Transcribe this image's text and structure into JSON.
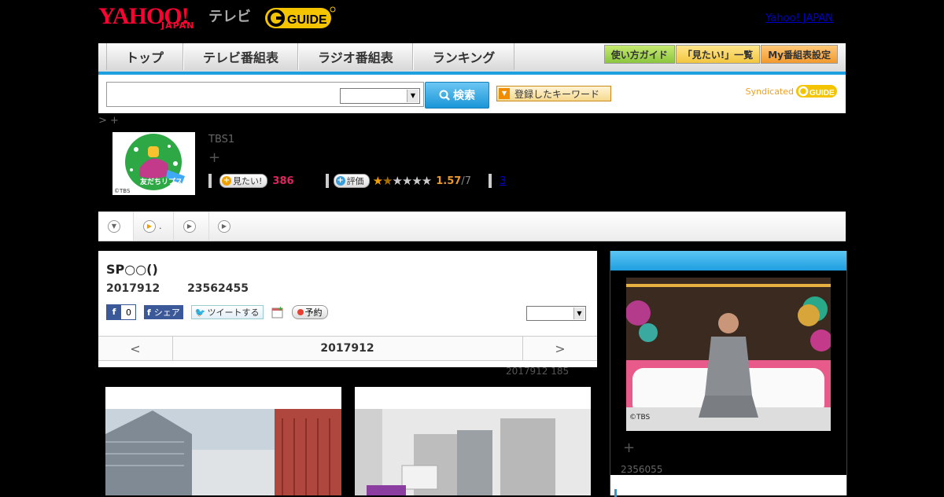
{
  "header": {
    "logo_yahoo": "YAHOO!",
    "logo_japan": "JAPAN",
    "logo_tv": "テレビ",
    "logo_gguide": "G GUIDE",
    "yahoo_japan_link": "Yahoo! JAPAN"
  },
  "nav": {
    "tabs": [
      "トップ",
      "テレビ番組表",
      "ラジオ番組表",
      "ランキング"
    ],
    "buttons": [
      {
        "label": "使い方ガイド",
        "color": "#9bd13b"
      },
      {
        "label": "「見たい!」一覧",
        "color": "#f2c640"
      },
      {
        "label": "My番組表設定",
        "color": "#f29a2e"
      }
    ]
  },
  "search": {
    "button_label": "検索",
    "keyword_button": "登録したキーワード",
    "syndicated": "Syndicated"
  },
  "breadcrumb": "> +",
  "program": {
    "thumb_caption": "友だちリプス",
    "thumb_credit": "©TBS",
    "channel": "TBS1",
    "plus": "+",
    "mitai_label": "見たい!",
    "mitai_count": "386",
    "hyoka_label": "評価",
    "rating": "1.57",
    "rating_denom": "/7",
    "rating_stars": 1.5,
    "link_count": "3"
  },
  "subtabs": [
    ".",
    "",
    ""
  ],
  "main": {
    "title": "SP○○()",
    "meta": "2017912 23562455",
    "fb_count": "0",
    "fb_share": "シェア",
    "tweet": "ツイートする",
    "reserve": "予約",
    "date_prev": "<",
    "date_label": "2017912",
    "date_next": ">",
    "note": "2017912  185"
  },
  "right": {
    "photo_credit": "©TBS",
    "plus": "+",
    "number": "2356055"
  },
  "colors": {
    "accent_blue": "#1ea0e0",
    "yahoo_red": "#ff0033",
    "gguide_yellow": "#f5c400"
  }
}
